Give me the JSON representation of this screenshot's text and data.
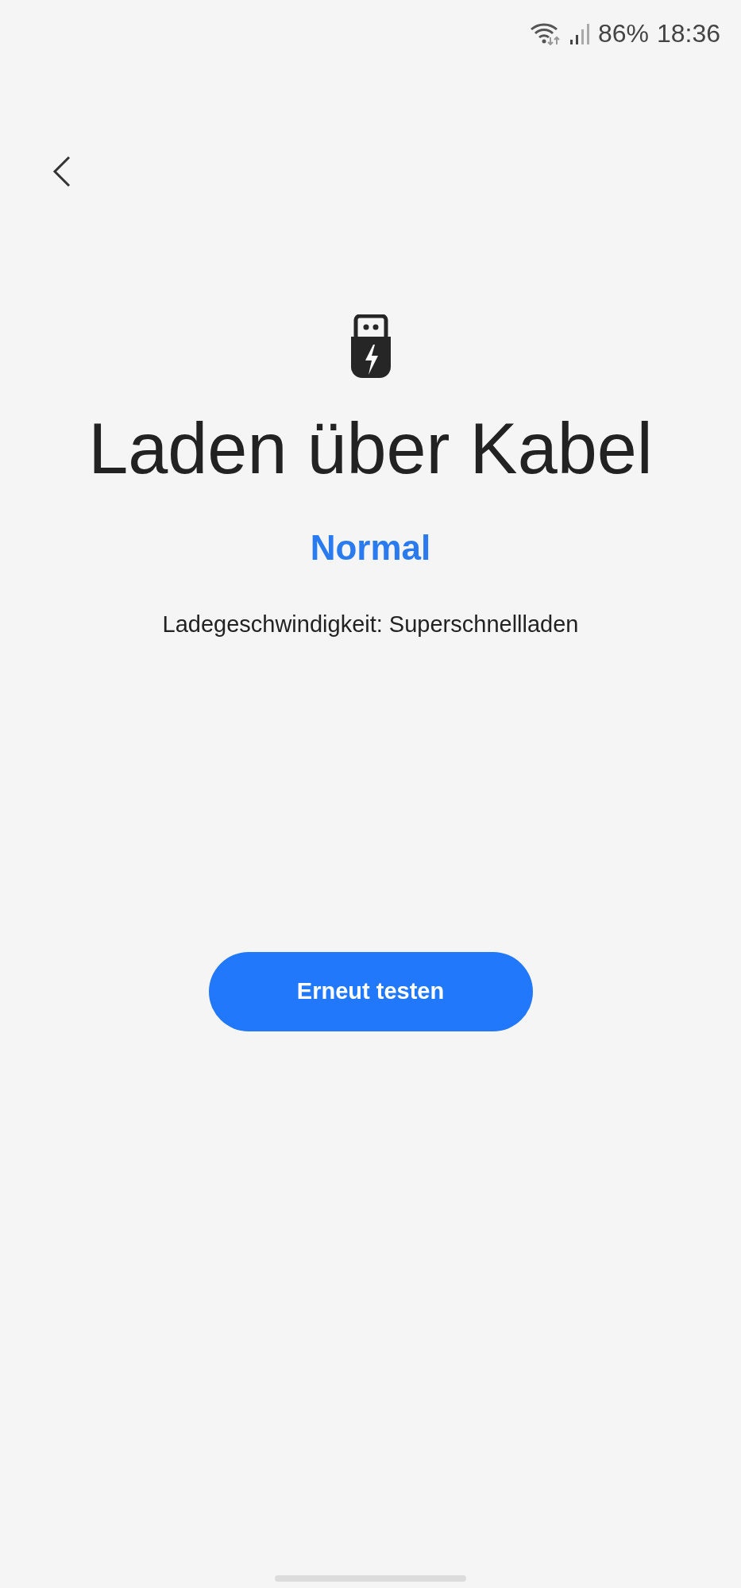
{
  "status_bar": {
    "battery": "86%",
    "time": "18:36"
  },
  "title": "Laden über Kabel",
  "result": "Normal",
  "detail": "Ladegeschwindigkeit: Superschnellladen",
  "button": "Erneut testen"
}
